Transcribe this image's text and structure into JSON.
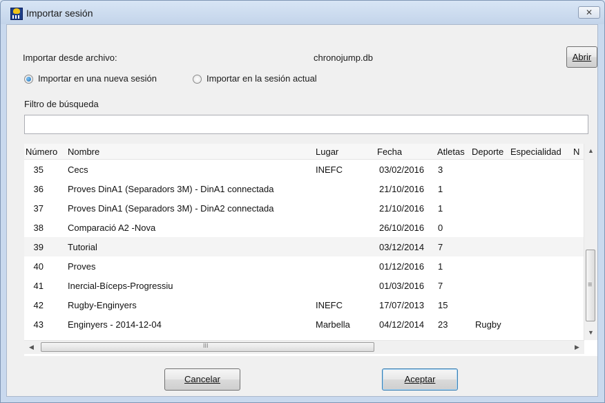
{
  "window": {
    "title": "Importar sesión",
    "close_glyph": "✕",
    "app_icon": "chronojump-app-icon"
  },
  "import": {
    "from_file_label": "Importar desde archivo:",
    "file_name": "chronojump.db",
    "open_button": "Abrir",
    "radio_new_session": "Importar en una nueva sesión",
    "radio_current_session": "Importar en la sesión actual",
    "selected_radio": "new_session"
  },
  "search": {
    "label": "Filtro de búsqueda",
    "value": ""
  },
  "table": {
    "columns": [
      "Número",
      "Nombre",
      "Lugar",
      "Fecha",
      "Atletas",
      "Deporte",
      "Especialidad",
      "N"
    ],
    "rows": [
      [
        "35",
        "Cecs",
        "INEFC",
        "03/02/2016",
        "3",
        "",
        ""
      ],
      [
        "36",
        "Proves DinA1 (Separadors 3M) - DinA1 connectada",
        "",
        "21/10/2016",
        "1",
        "",
        ""
      ],
      [
        "37",
        "Proves DinA1 (Separadors 3M) - DinA2 connectada",
        "",
        "21/10/2016",
        "1",
        "",
        ""
      ],
      [
        "38",
        "Comparació A2 -Nova",
        "",
        "26/10/2016",
        "0",
        "",
        ""
      ],
      [
        "39",
        "Tutorial",
        "",
        "03/12/2014",
        "7",
        "",
        ""
      ],
      [
        "40",
        "Proves",
        "",
        "01/12/2016",
        "1",
        "",
        ""
      ],
      [
        "41",
        "Inercial-Bíceps-Progressiu",
        "",
        "01/03/2016",
        "7",
        "",
        ""
      ],
      [
        "42",
        "Rugby-Enginyers",
        "INEFC",
        "17/07/2013",
        "15",
        "",
        ""
      ],
      [
        "43",
        "Enginyers - 2014-12-04",
        "Marbella",
        "04/12/2014",
        "23",
        "Rugby",
        ""
      ]
    ],
    "highlighted_row": 4
  },
  "scroll": {
    "up_arrow": "▲",
    "down_arrow": "▼",
    "left_arrow": "◀",
    "right_arrow": "▶",
    "v_grip": "≡",
    "h_grip": "III"
  },
  "buttons": {
    "cancel": "Cancelar",
    "accept": "Aceptar"
  }
}
